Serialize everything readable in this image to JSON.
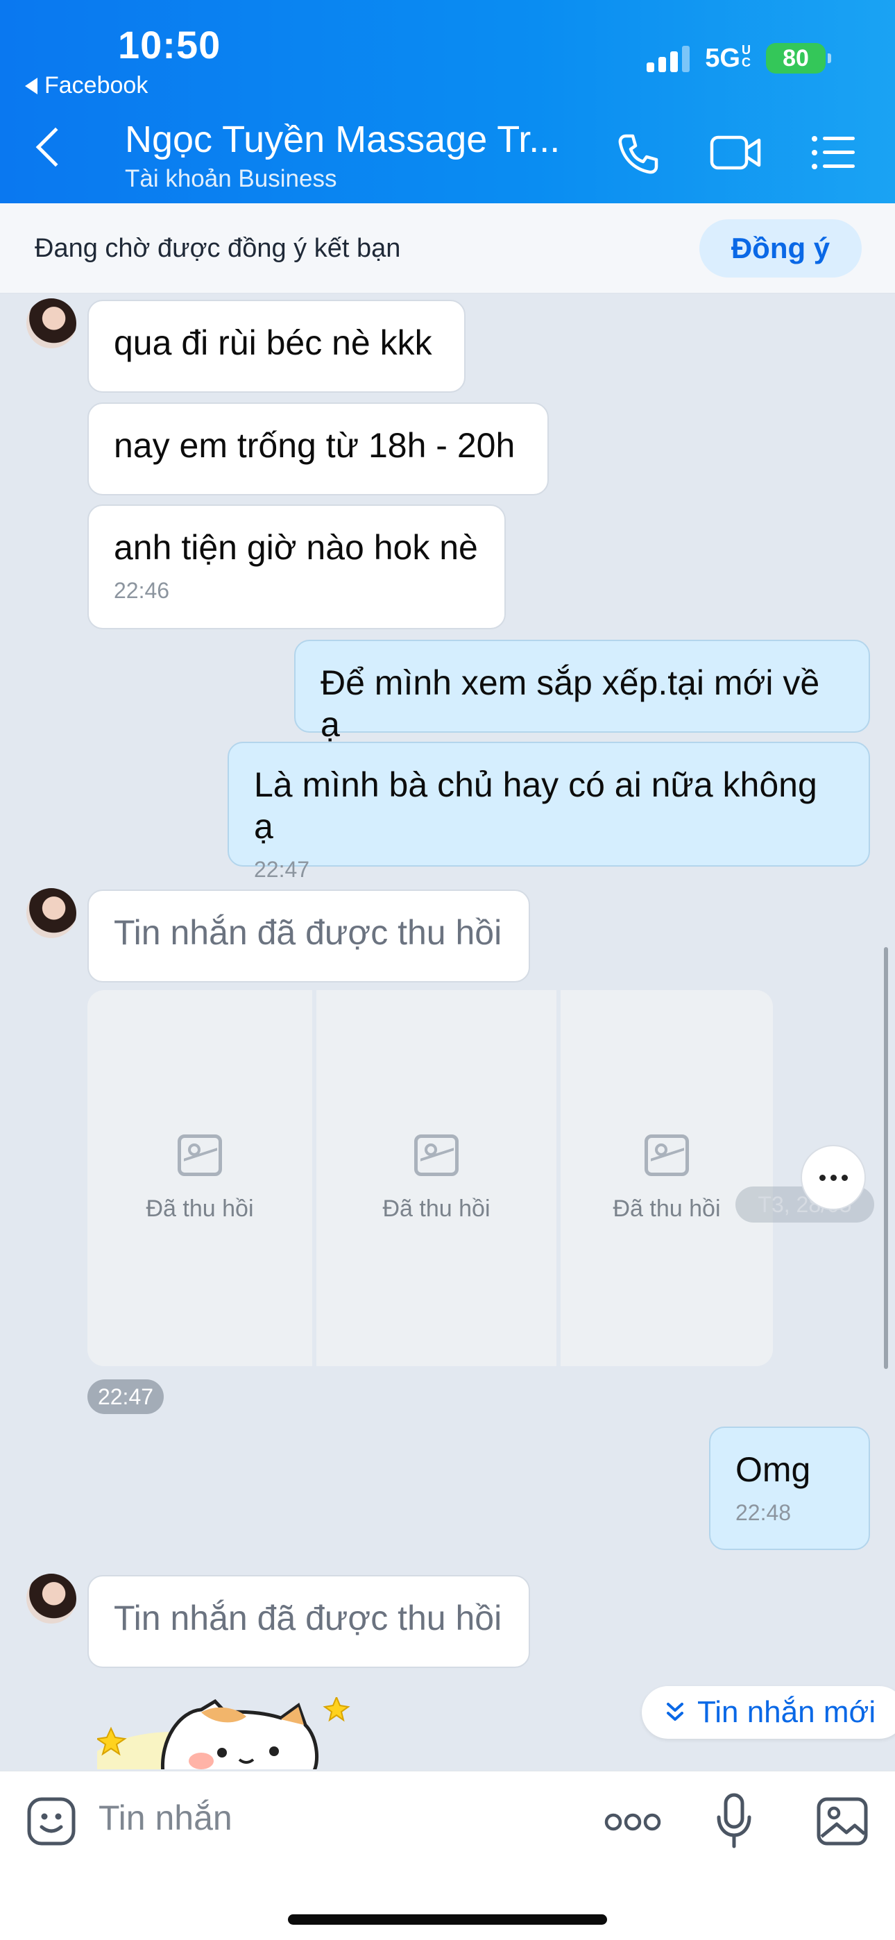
{
  "status": {
    "time": "10:50",
    "back_app": "Facebook",
    "network": "5G",
    "network_sub": [
      "U",
      "C"
    ],
    "battery": "80"
  },
  "header": {
    "name": "Ngọc Tuyền Massage Tr...",
    "subtitle": "Tài khoản Business"
  },
  "friend_request": {
    "text": "Đang chờ được đồng ý kết bạn",
    "accept": "Đồng ý"
  },
  "messages": [
    {
      "text": "qua đi rùi béc nè kkk"
    },
    {
      "text": "nay em trống từ 18h - 20h"
    },
    {
      "text": "anh tiện giờ nào hok nè",
      "time": "22:46"
    },
    {
      "text": "Để mình xem sắp xếp.tại mới về ạ"
    },
    {
      "text": "Là mình bà chủ hay có ai nữa không ạ",
      "time": "22:47"
    },
    {
      "text": "Tin nhắn đã được thu hồi"
    },
    {
      "text": "Omg",
      "time": "22:48"
    },
    {
      "text": "Tin nhắn đã được thu hồi"
    }
  ],
  "recalled_images": [
    "Đã thu hồi",
    "Đã thu hồi",
    "Đã thu hồi"
  ],
  "date_pill": "T3, 28/05",
  "image_time": "22:47",
  "new_messages": "Tin nhắn mới",
  "input": {
    "placeholder": "Tin nhắn"
  },
  "colors": {
    "header": "#0a78f0",
    "accent": "#0a68e6",
    "incoming_bubble": "#ffffff",
    "outgoing_bubble": "#d5eefe",
    "chat_background": "#e2e8f0"
  }
}
